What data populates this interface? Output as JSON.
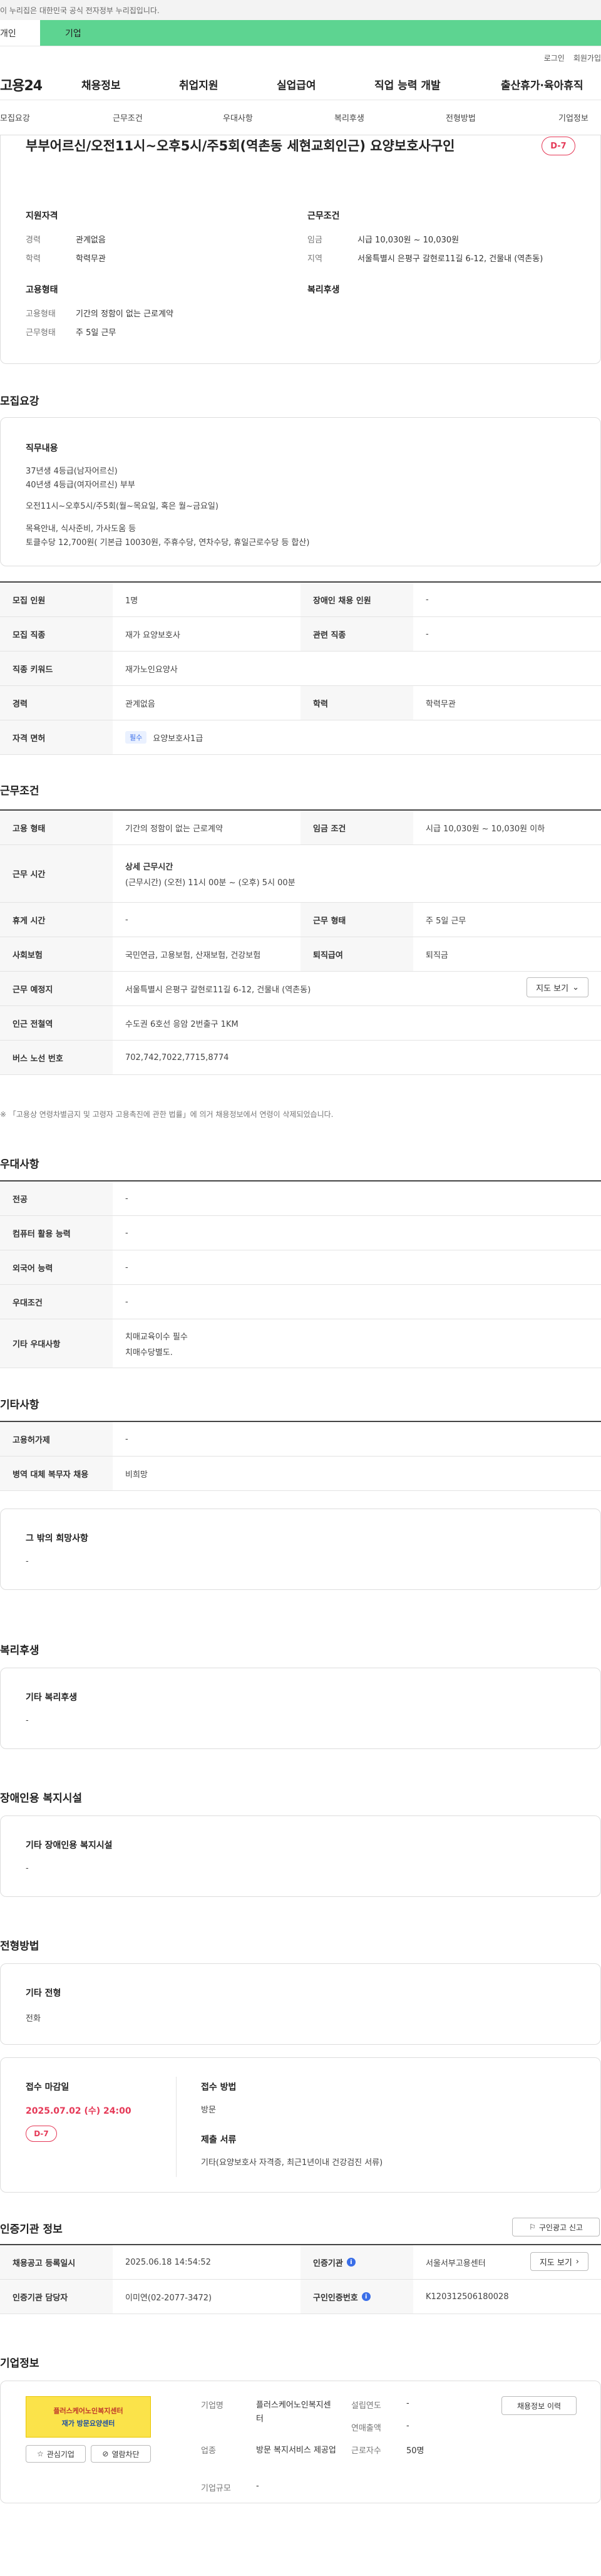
{
  "gov_bar": {
    "text": "이 누리집은 대한민국 공식 전자정부 누리집입니다."
  },
  "user_tabs": {
    "personal": "개인",
    "company": "기업"
  },
  "util": {
    "login": "로그인",
    "signup": "회원가입"
  },
  "gnb": {
    "logo": "고용24",
    "items": [
      "채용정보",
      "취업지원",
      "실업급여",
      "직업 능력 개발",
      "출산휴가·육아휴직"
    ]
  },
  "subnav": {
    "items": [
      "모집요강",
      "근무조건",
      "우대사항",
      "복리후생",
      "전형방법",
      "기업정보"
    ]
  },
  "summary": {
    "title": "부부어르신/오전11시~오후5시/주5회(역촌동 세현교회인근) 요양보호사구인",
    "dday": "D-7",
    "qual_heading": "지원자격",
    "career_label": "경력",
    "career_value": "관계없음",
    "edu_label": "학력",
    "edu_value": "학력무관",
    "cond_heading": "근무조건",
    "wage_label": "임금",
    "wage_value": "시급 10,030원 ~ 10,030원",
    "region_label": "지역",
    "region_value": "서울특별시 은평구 갈현로11길 6-12, 건물내 (역촌동)",
    "emp_heading": "고용형태",
    "emp_label": "고용형태",
    "emp_value": "기간의 정함이 없는 근로계약",
    "worktype_label": "근무형태",
    "worktype_value": "주 5일 근무",
    "welfare_heading": "복리후생"
  },
  "recruit": {
    "section_title": "모집요강",
    "duty_heading": "직무내용",
    "duty_lines": [
      "37년생 4등급(남자어르신)",
      "40년생 4등급(여자어르신) 부부",
      "",
      "오전11시~오후5시/주5회(월~목요일, 혹은 월~금요일)",
      "",
      "목욕안내, 식사준비, 가사도움 등",
      "토클수당 12,700원( 기본급 10030원, 주휴수당, 연차수당, 휴일근로수당 등 합산)"
    ],
    "rows": {
      "count_label": "모집 인원",
      "count_value": "1명",
      "disabled_label": "장애인 채용 인원",
      "disabled_value": "-",
      "job_label": "모집 직종",
      "job_value": "재가 요양보호사",
      "related_label": "관련 직종",
      "related_value": "-",
      "keyword_label": "직종 키워드",
      "keyword_value": "재가노인요양사",
      "career_label": "경력",
      "career_value": "관계없음",
      "edu_label": "학력",
      "edu_value": "학력무관",
      "license_label": "자격 면허",
      "license_badge": "필수",
      "license_value": "요양보호사1급"
    }
  },
  "conditions": {
    "section_title": "근무조건",
    "emp_label": "고용 형태",
    "emp_value": "기간의 정함이 없는 근로계약",
    "wage_label": "임금 조건",
    "wage_value": "시급 10,030원 ~ 10,030원 이하",
    "time_label": "근무 시간",
    "time_heading": "상세 근무시간",
    "time_value": "(근무시간) (오전) 11시 00분 ~ (오후) 5시 00분",
    "rest_label": "휴게 시간",
    "rest_value": "-",
    "form_label": "근무 형태",
    "form_value": "주 5일 근무",
    "insurance_label": "사회보험",
    "insurance_value": "국민연금, 고용보험, 산재보험, 건강보험",
    "retire_label": "퇴직급여",
    "retire_value": "퇴직금",
    "place_label": "근무 예정지",
    "place_value": "서울특별시 은평구 갈현로11길 6-12, 건물내 (역촌동)",
    "map_btn": "지도 보기",
    "subway_label": "인근 전철역",
    "subway_value": "수도권 6호선 응암 2번출구 1KM",
    "bus_label": "버스 노선 번호",
    "bus_value": "702,742,7022,7715,8774",
    "note": "※ 「고용상 연령차별금지 및 고령자 고용촉진에 관한 법률」에 의거 채용정보에서 연령이 삭제되었습니다."
  },
  "preferences": {
    "section_title": "우대사항",
    "major_label": "전공",
    "major_value": "-",
    "computer_label": "컴퓨터 활용 능력",
    "computer_value": "-",
    "lang_label": "외국어 능력",
    "lang_value": "-",
    "pref_label": "우대조건",
    "pref_value": "-",
    "other_label": "기타 우대사항",
    "other_lines": [
      "치매교육이수 필수",
      "치매수당별도."
    ]
  },
  "etc": {
    "section_title": "기타사항",
    "disabled_label": "고용허가제",
    "disabled_value": "-",
    "military_label": "병역 대체 복무자 채용",
    "military_value": "비희망",
    "other_heading": "그 밖의 희망사항",
    "other_value": "-"
  },
  "welfare": {
    "section_title": "복리후생",
    "heading": "기타 복리후생",
    "value": "-"
  },
  "facility": {
    "section_title": "장애인용 복지시설",
    "heading": "기타 장애인용 복지시설",
    "value": "-"
  },
  "screening": {
    "section_title": "전형방법",
    "method_heading": "기타 전형",
    "method_value": "전화",
    "deadline_heading": "접수 마감일",
    "deadline_value": "2025.07.02 (수) 24:00",
    "dday": "D-7",
    "apply_heading": "접수 방법",
    "apply_value": "방문",
    "docs_heading": "제출 서류",
    "docs_value": "기타(요양보호사 자격증, 최근1년이내 건강검진 서류)"
  },
  "agency": {
    "section_title": "인증기관 정보",
    "ad_btn": "구인광고 신고",
    "reg_label": "채용공고 등록일시",
    "reg_value": "2025.06.18 14:54:52",
    "org_label": "인증기관",
    "org_value": "서울서부고용센터",
    "map_btn": "지도 보기",
    "manager_label": "인증기관 담당자",
    "manager_value": "이미연(02-2077-3472)",
    "cert_label": "구인인증번호",
    "cert_value": "K120312506180028"
  },
  "company": {
    "section_title": "기업정보",
    "logo_line1": "플러스케어노인복지센터",
    "logo_line2": "재가 방문요양센터",
    "interest_btn": "관심기업",
    "block_btn": "열람차단",
    "name_label": "기업명",
    "name_value": "플러스케어노인복지센터",
    "industry_label": "업종",
    "industry_value": "방문 복지서비스 제공업",
    "size_label": "기업규모",
    "size_value": "-",
    "founded_label": "설립연도",
    "founded_value": "-",
    "sales_label": "연매출액",
    "sales_value": "-",
    "staff_label": "근로자수",
    "staff_value": "50명",
    "detail_btn": "채용정보 이력"
  }
}
